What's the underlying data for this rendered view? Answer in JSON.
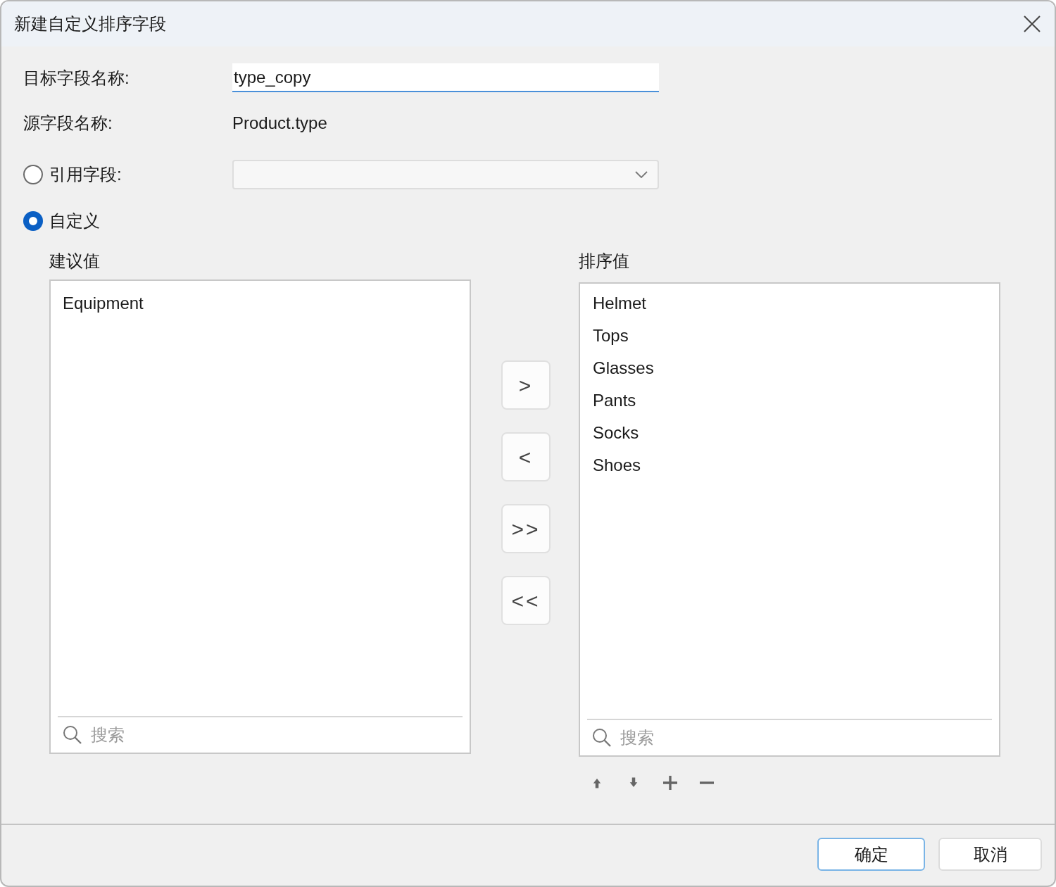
{
  "window": {
    "title": "新建自定义排序字段"
  },
  "target_field": {
    "label": "目标字段名称:",
    "value": "type_copy"
  },
  "source_field": {
    "label": "源字段名称:",
    "value": "Product.type"
  },
  "mode_options": [
    {
      "label": "引用字段:",
      "selected": false,
      "kind": "dropdown"
    },
    {
      "label": "自定义",
      "selected": true,
      "kind": "plain"
    }
  ],
  "suggested": {
    "title": "建议值",
    "items": [
      "Equipment"
    ],
    "search": {
      "placeholder": "搜索"
    }
  },
  "transfer_buttons": [
    ">",
    "<",
    ">>",
    "<<"
  ],
  "sorted": {
    "title": "排序值",
    "items": [
      "Helmet",
      "Tops",
      "Glasses",
      "Pants",
      "Socks",
      "Shoes"
    ],
    "search": {
      "placeholder": "搜索"
    }
  },
  "buttons": [
    {
      "label": "确定",
      "default": true
    },
    {
      "label": "取消",
      "default": false
    }
  ]
}
